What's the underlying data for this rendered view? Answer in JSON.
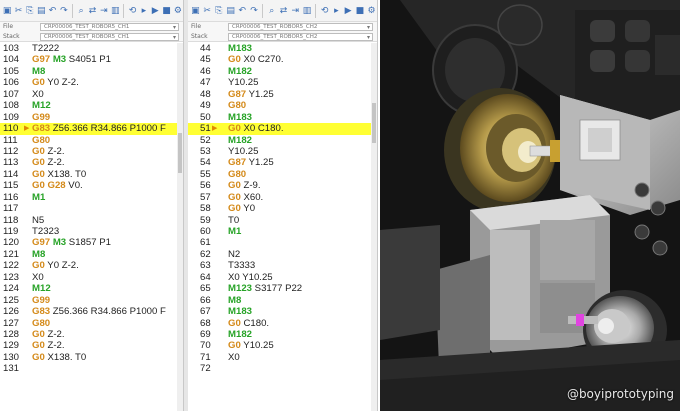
{
  "channel1": {
    "program": "CRP00006_TEST_ROBOR5_CH1",
    "program2": "CRP00006_TEST_ROBOR5_CH1",
    "label1": "File",
    "label2": "Stack",
    "lines": [
      {
        "n": "103",
        "t": [
          [
            "T2222",
            "plain"
          ]
        ]
      },
      {
        "n": "104",
        "t": [
          [
            "G97",
            "orange"
          ],
          [
            " ",
            "plain"
          ],
          [
            "M3",
            "green"
          ],
          [
            " S4051 P1",
            "plain"
          ]
        ]
      },
      {
        "n": "105",
        "t": [
          [
            "M8",
            "green"
          ]
        ]
      },
      {
        "n": "106",
        "t": [
          [
            "G0",
            "orange"
          ],
          [
            " Y0 Z-2.",
            "plain"
          ]
        ]
      },
      {
        "n": "107",
        "t": [
          [
            "X0",
            "plain"
          ]
        ]
      },
      {
        "n": "108",
        "t": [
          [
            "M12",
            "green"
          ]
        ]
      },
      {
        "n": "109",
        "t": [
          [
            "G99",
            "orange"
          ]
        ]
      },
      {
        "n": "110",
        "t": [
          [
            "G83",
            "orange"
          ],
          [
            " Z56.366 R34.866 P1000 F",
            "plain"
          ]
        ],
        "hl": true,
        "arrow": true
      },
      {
        "n": "111",
        "t": [
          [
            "G80",
            "orange"
          ]
        ]
      },
      {
        "n": "112",
        "t": [
          [
            "G0",
            "orange"
          ],
          [
            " Z-2.",
            "plain"
          ]
        ]
      },
      {
        "n": "113",
        "t": [
          [
            "G0",
            "orange"
          ],
          [
            " Z-2.",
            "plain"
          ]
        ]
      },
      {
        "n": "114",
        "t": [
          [
            "G0",
            "orange"
          ],
          [
            " X138. T0",
            "plain"
          ]
        ]
      },
      {
        "n": "115",
        "t": [
          [
            "G0",
            "orange"
          ],
          [
            " ",
            "plain"
          ],
          [
            "G28",
            "orange"
          ],
          [
            " V0.",
            "plain"
          ]
        ]
      },
      {
        "n": "116",
        "t": [
          [
            "M1",
            "green"
          ]
        ]
      },
      {
        "n": "117",
        "t": []
      },
      {
        "n": "118",
        "t": [
          [
            "N5",
            "plain"
          ]
        ]
      },
      {
        "n": "119",
        "t": [
          [
            "T2323",
            "plain"
          ]
        ]
      },
      {
        "n": "120",
        "t": [
          [
            "G97",
            "orange"
          ],
          [
            " ",
            "plain"
          ],
          [
            "M3",
            "green"
          ],
          [
            " S1857 P1",
            "plain"
          ]
        ]
      },
      {
        "n": "121",
        "t": [
          [
            "M8",
            "green"
          ]
        ]
      },
      {
        "n": "122",
        "t": [
          [
            "G0",
            "orange"
          ],
          [
            " Y0 Z-2.",
            "plain"
          ]
        ]
      },
      {
        "n": "123",
        "t": [
          [
            "X0",
            "plain"
          ]
        ]
      },
      {
        "n": "124",
        "t": [
          [
            "M12",
            "green"
          ]
        ]
      },
      {
        "n": "125",
        "t": [
          [
            "G99",
            "orange"
          ]
        ]
      },
      {
        "n": "126",
        "t": [
          [
            "G83",
            "orange"
          ],
          [
            " Z56.366 R34.866 P1000 F",
            "plain"
          ]
        ]
      },
      {
        "n": "127",
        "t": [
          [
            "G80",
            "orange"
          ]
        ]
      },
      {
        "n": "128",
        "t": [
          [
            "G0",
            "orange"
          ],
          [
            " Z-2.",
            "plain"
          ]
        ]
      },
      {
        "n": "129",
        "t": [
          [
            "G0",
            "orange"
          ],
          [
            " Z-2.",
            "plain"
          ]
        ]
      },
      {
        "n": "130",
        "t": [
          [
            "G0",
            "orange"
          ],
          [
            " X138. T0",
            "plain"
          ]
        ]
      },
      {
        "n": "131",
        "t": []
      }
    ]
  },
  "channel2": {
    "program": "CRP00006_TEST_ROBOR5_CH2",
    "program2": "CRP00006_TEST_ROBOR5_CH2",
    "label1": "File",
    "label2": "Stack",
    "lines": [
      {
        "n": "44",
        "t": [
          [
            "M183",
            "green"
          ]
        ]
      },
      {
        "n": "45",
        "t": [
          [
            "G0",
            "orange"
          ],
          [
            " X0 C270.",
            "plain"
          ]
        ]
      },
      {
        "n": "46",
        "t": [
          [
            "M182",
            "green"
          ]
        ]
      },
      {
        "n": "47",
        "t": [
          [
            "Y10.25",
            "plain"
          ]
        ]
      },
      {
        "n": "48",
        "t": [
          [
            "G87",
            "orange"
          ],
          [
            " Y1.25",
            "plain"
          ]
        ]
      },
      {
        "n": "49",
        "t": [
          [
            "G80",
            "orange"
          ]
        ]
      },
      {
        "n": "50",
        "t": [
          [
            "M183",
            "green"
          ]
        ]
      },
      {
        "n": "51",
        "t": [
          [
            "G0",
            "orange"
          ],
          [
            " X0 C180.",
            "plain"
          ]
        ],
        "hl": true,
        "arrow": true
      },
      {
        "n": "52",
        "t": [
          [
            "M182",
            "green"
          ]
        ]
      },
      {
        "n": "53",
        "t": [
          [
            "Y10.25",
            "plain"
          ]
        ]
      },
      {
        "n": "54",
        "t": [
          [
            "G87",
            "orange"
          ],
          [
            " Y1.25",
            "plain"
          ]
        ]
      },
      {
        "n": "55",
        "t": [
          [
            "G80",
            "orange"
          ]
        ]
      },
      {
        "n": "56",
        "t": [
          [
            "G0",
            "orange"
          ],
          [
            " Z-9.",
            "plain"
          ]
        ]
      },
      {
        "n": "57",
        "t": [
          [
            "G0",
            "orange"
          ],
          [
            " X60.",
            "plain"
          ]
        ]
      },
      {
        "n": "58",
        "t": [
          [
            "G0",
            "orange"
          ],
          [
            " Y0",
            "plain"
          ]
        ]
      },
      {
        "n": "59",
        "t": [
          [
            "T0",
            "plain"
          ]
        ]
      },
      {
        "n": "60",
        "t": [
          [
            "M1",
            "green"
          ]
        ]
      },
      {
        "n": "61",
        "t": []
      },
      {
        "n": "62",
        "t": [
          [
            "N2",
            "plain"
          ]
        ]
      },
      {
        "n": "63",
        "t": [
          [
            "T3333",
            "plain"
          ]
        ]
      },
      {
        "n": "64",
        "t": [
          [
            "X0 Y10.25",
            "plain"
          ]
        ]
      },
      {
        "n": "65",
        "t": [
          [
            "M123",
            "green"
          ],
          [
            " S3177 P22",
            "plain"
          ]
        ]
      },
      {
        "n": "66",
        "t": [
          [
            "M8",
            "green"
          ]
        ]
      },
      {
        "n": "67",
        "t": [
          [
            "M183",
            "green"
          ]
        ]
      },
      {
        "n": "68",
        "t": [
          [
            "G0",
            "orange"
          ],
          [
            " C180.",
            "plain"
          ]
        ]
      },
      {
        "n": "69",
        "t": [
          [
            "M182",
            "green"
          ]
        ]
      },
      {
        "n": "70",
        "t": [
          [
            "G0",
            "orange"
          ],
          [
            " Y10.25",
            "plain"
          ]
        ]
      },
      {
        "n": "71",
        "t": [
          [
            "X0",
            "plain"
          ]
        ]
      },
      {
        "n": "72",
        "t": []
      }
    ]
  },
  "toolbar_icons": [
    "save-icon",
    "cut-icon",
    "copy-icon",
    "paste-icon",
    "undo-icon",
    "redo-icon",
    "find-icon",
    "replace-icon",
    "goto-icon",
    "compare-icon",
    "sync-icon",
    "step-icon",
    "run-icon",
    "stop-icon",
    "settings-icon"
  ],
  "toolbar_glyphs": [
    "▣",
    "✂",
    "⎘",
    "▤",
    "↶",
    "↷",
    "⌕",
    "⇄",
    "⇥",
    "▥",
    "⟲",
    "▸",
    "▶",
    "■",
    "⚙"
  ],
  "simulation": {
    "watermark": "@boyiprototyping"
  },
  "colors": {
    "gcode": "#d48a1a",
    "mcode": "#27a327",
    "highlight": "#ffff33"
  }
}
